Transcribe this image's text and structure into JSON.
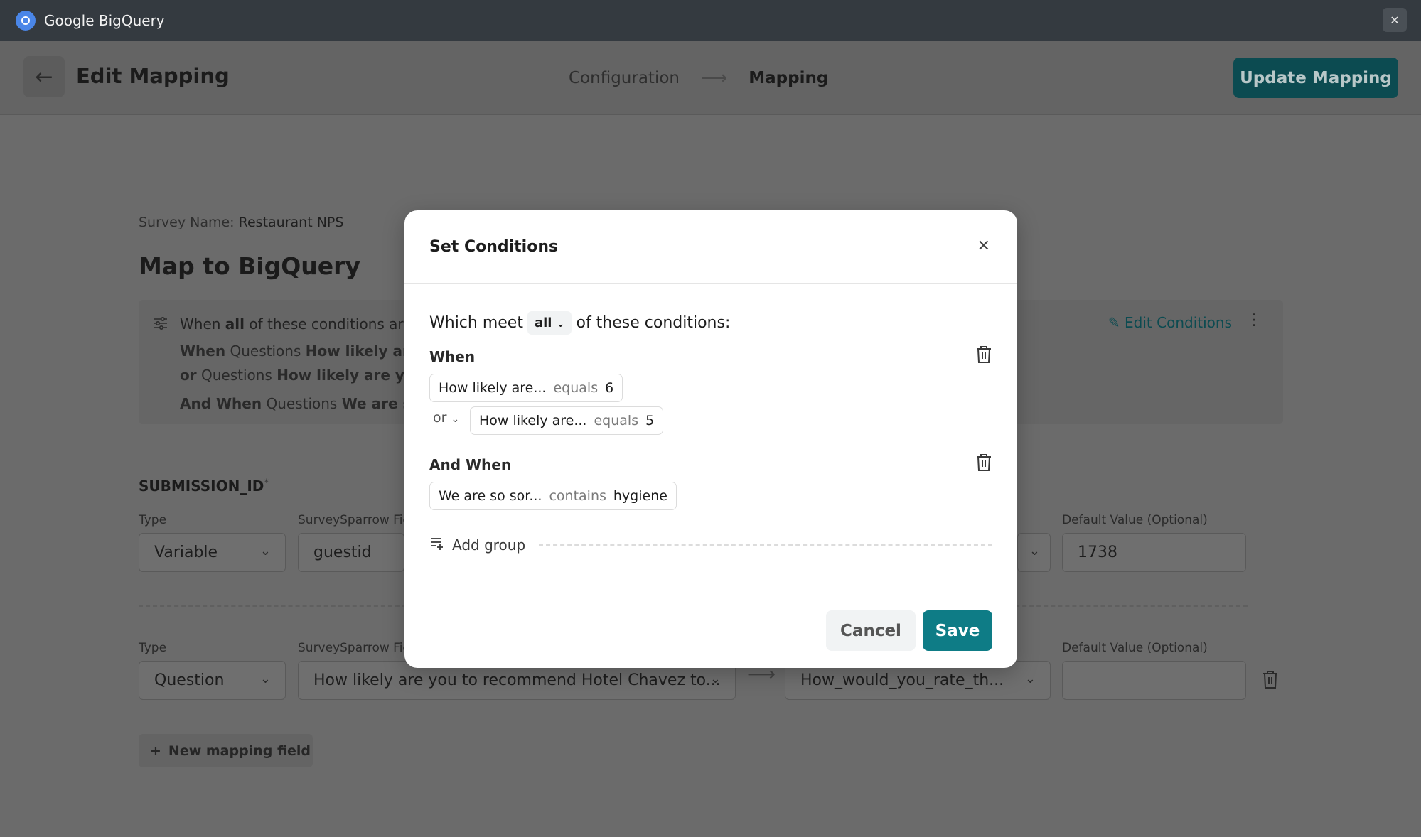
{
  "app": {
    "title": "Google BigQuery",
    "close_glyph": "✕"
  },
  "header": {
    "back_glyph": "←",
    "title": "Edit Mapping",
    "steps": [
      "Configuration",
      "Mapping"
    ],
    "step_arrow": "⟶",
    "update_label": "Update Mapping"
  },
  "bg": {
    "survey_label": "Survey Name: ",
    "survey_name": "Restaurant NPS",
    "map_title": "Map to BigQuery",
    "conditions": {
      "l1_pre": "When ",
      "l1_bold": "all",
      "l1_post": " of these conditions are n",
      "l2_bold": "When",
      "l2_text": " Questions ",
      "l2_q": "How likely are y",
      "l3_bold": "or",
      "l3_text": " Questions ",
      "l3_q": "How likely are you t",
      "l4_bold": "And When",
      "l4_text": " Questions ",
      "l4_q": "We are so s",
      "edit_label": "Edit Conditions",
      "kebab": "⋮"
    },
    "field1": {
      "name": "SUBMISSION_ID",
      "asterisk": "*",
      "type_label": "Type",
      "type_value": "Variable",
      "ss_label": "SurveySparrow Fie",
      "ss_value": "guestid",
      "default_label": "Default Value (Optional)",
      "default_value": "1738"
    },
    "field2": {
      "type_label": "Type",
      "type_value": "Question",
      "ss_label": "SurveySparrow Fie",
      "ss_value": "How likely are you to recommend Hotel Chavez to...",
      "bq_value": "How_would_you_rate_th...",
      "default_label": "Default Value (Optional)",
      "default_value": ""
    },
    "new_field_label": "New mapping field",
    "plus_glyph": "+"
  },
  "modal": {
    "title": "Set Conditions",
    "close_glyph": "✕",
    "which_pre": "Which meet",
    "which_select": "all",
    "which_post": "of these conditions:",
    "groups": [
      {
        "label": "When",
        "conditions": [
          {
            "question": "How likely are...",
            "op": "equals",
            "value": "6"
          },
          {
            "joiner": "or",
            "question": "How likely are...",
            "op": "equals",
            "value": "5"
          }
        ]
      },
      {
        "label": "And When",
        "conditions": [
          {
            "question": "We are so sor...",
            "op": "contains",
            "value": "hygiene"
          }
        ]
      }
    ],
    "add_group_label": "Add group",
    "cancel_label": "Cancel",
    "save_label": "Save"
  },
  "colors": {
    "accent": "#0e7c86",
    "update_button": "#0c4b51"
  }
}
